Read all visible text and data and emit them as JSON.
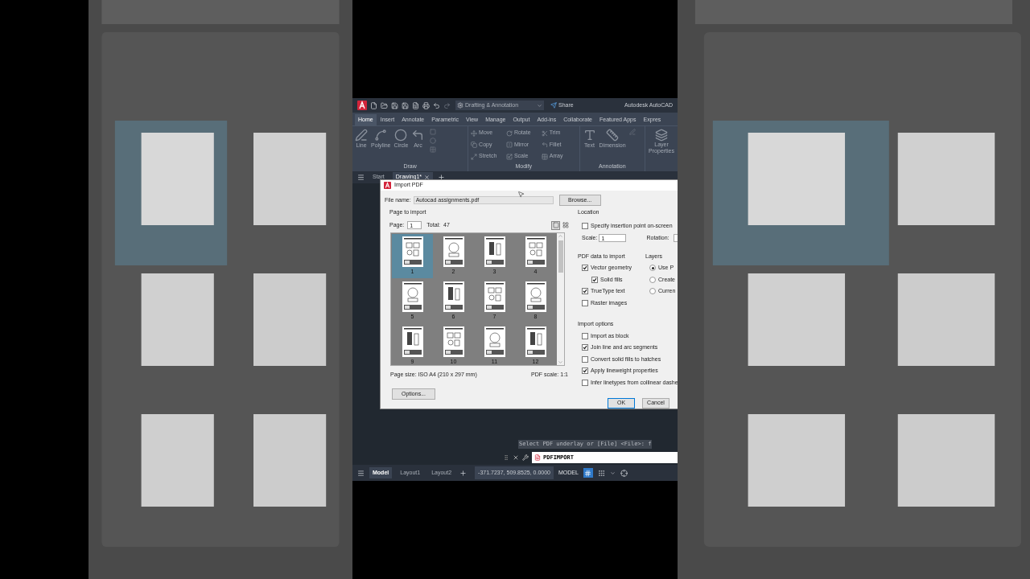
{
  "title_bar": {
    "workspace": "Drafting & Annotation",
    "share": "Share",
    "title": "Autodesk AutoCAD"
  },
  "ribbon_tabs": [
    {
      "label": "Home",
      "selected": true
    },
    {
      "label": "Insert",
      "selected": false
    },
    {
      "label": "Annotate",
      "selected": false
    },
    {
      "label": "Parametric",
      "selected": false
    },
    {
      "label": "View",
      "selected": false
    },
    {
      "label": "Manage",
      "selected": false
    },
    {
      "label": "Output",
      "selected": false
    },
    {
      "label": "Add-ins",
      "selected": false
    },
    {
      "label": "Collaborate",
      "selected": false
    },
    {
      "label": "Featured Apps",
      "selected": false
    },
    {
      "label": "Expres",
      "selected": false
    }
  ],
  "draw_panel": {
    "title": "Draw",
    "tools": [
      "Line",
      "Polyline",
      "Circle",
      "Arc"
    ]
  },
  "modify_panel": {
    "title": "Modify",
    "tools": [
      "Move",
      "Rotate",
      "Trim",
      "Copy",
      "Mirror",
      "Fillet",
      "Stretch",
      "Scale",
      "Array"
    ]
  },
  "annotation_panel": {
    "title": "Annotation",
    "tools": [
      "Text",
      "Dimension"
    ]
  },
  "layers_panel": {
    "tool_lines": [
      "Layer",
      "Properties"
    ]
  },
  "file_tabs": [
    {
      "label": "Start",
      "selected": false
    },
    {
      "label": "Drawing1*",
      "selected": true
    }
  ],
  "dialog": {
    "title": "Import PDF",
    "file_label": "File name:",
    "file_value": "Autocad assignments.pdf",
    "browse": "Browse...",
    "page_group": "Page to import",
    "page_label": "Page:",
    "page_value": "1",
    "total_label": "Total:",
    "total_value": "47",
    "view_modes": [
      {
        "kind": "single",
        "selected": true
      },
      {
        "kind": "grid",
        "selected": false
      }
    ],
    "pages": [
      {
        "label": "1",
        "selected": true
      },
      {
        "label": "2",
        "selected": false
      },
      {
        "label": "3",
        "selected": false
      },
      {
        "label": "4",
        "selected": false
      },
      {
        "label": "5",
        "selected": false
      },
      {
        "label": "6",
        "selected": false
      },
      {
        "label": "7",
        "selected": false
      },
      {
        "label": "8",
        "selected": false
      },
      {
        "label": "9",
        "selected": false
      },
      {
        "label": "10",
        "selected": false
      },
      {
        "label": "11",
        "selected": false
      },
      {
        "label": "12",
        "selected": false
      }
    ],
    "page_size": "Page size: ISO A4 (210 x 297 mm)",
    "pdf_scale": "PDF scale: 1:1",
    "options_button": "Options...",
    "location": {
      "title": "Location",
      "specify": {
        "label": "Specify insertion point on-screen",
        "checked": false
      },
      "scale_label": "Scale:",
      "scale_value": "1",
      "rotation_label": "Rotation:"
    },
    "pdf_data": {
      "title": "PDF data to import",
      "items": [
        {
          "label": "Vector geometry",
          "checked": true,
          "children": [
            {
              "label": "Solid fills",
              "checked": true
            }
          ]
        },
        {
          "label": "TrueType text",
          "checked": true
        },
        {
          "label": "Raster images",
          "checked": false
        }
      ]
    },
    "layers": {
      "title": "Layers",
      "options": [
        {
          "label": "Use P",
          "selected": true
        },
        {
          "label": "Create",
          "selected": false
        },
        {
          "label": "Curren",
          "selected": false
        }
      ]
    },
    "import_options": {
      "title": "Import options",
      "items": [
        {
          "label": "Import as block",
          "checked": false
        },
        {
          "label": "Join line and arc segments",
          "checked": true
        },
        {
          "label": "Convert solid fills to hatches",
          "checked": false
        },
        {
          "label": "Apply lineweight properties",
          "checked": true
        },
        {
          "label": "Infer linetypes from collinear dashe",
          "checked": false
        }
      ]
    },
    "buttons": [
      "OK",
      "Cancel"
    ]
  },
  "command_line": {
    "history": "Select PDF underlay or [File] <File>: f",
    "input": "PDFIMPORT"
  },
  "layout_tabs": [
    {
      "label": "Model",
      "selected": true
    },
    {
      "label": "Layout1",
      "selected": false
    },
    {
      "label": "Layout2",
      "selected": false
    }
  ],
  "status_bar": {
    "coordinates": "-371.7237, 509.8525, 0.0000",
    "space": "MODEL",
    "grid_on": true
  }
}
